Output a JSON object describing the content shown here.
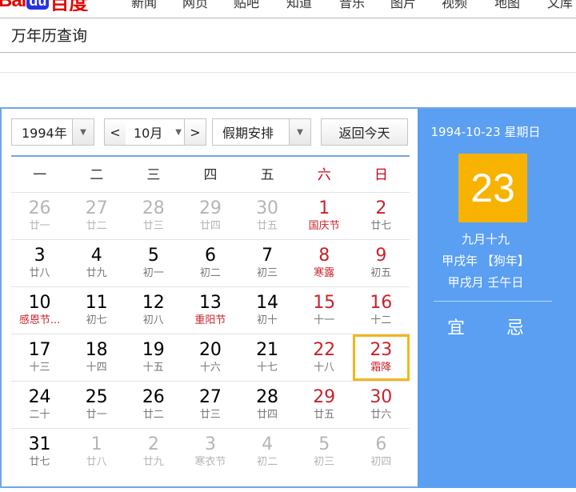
{
  "nav": {
    "logo_bai": "Bai",
    "logo_du": "du",
    "logo_cn": "百度",
    "items": [
      "新闻",
      "网页",
      "贴吧",
      "知道",
      "音乐",
      "图片",
      "视频",
      "地图",
      "文库"
    ]
  },
  "search": {
    "query": "万年历查询"
  },
  "controls": {
    "year": "1994年",
    "prev": "<",
    "month": "10月",
    "next": ">",
    "holiday": "假期安排",
    "today": "返回今天"
  },
  "weekdays": [
    "一",
    "二",
    "三",
    "四",
    "五",
    "六",
    "日"
  ],
  "weeks": [
    [
      {
        "day": "26",
        "lunar": "廿一",
        "other": true
      },
      {
        "day": "27",
        "lunar": "廿二",
        "other": true
      },
      {
        "day": "28",
        "lunar": "廿三",
        "other": true
      },
      {
        "day": "29",
        "lunar": "廿四",
        "other": true
      },
      {
        "day": "30",
        "lunar": "廿五",
        "other": true
      },
      {
        "day": "1",
        "lunar": "国庆节",
        "festival": true,
        "weekend": true
      },
      {
        "day": "2",
        "lunar": "廿七",
        "weekend": true
      }
    ],
    [
      {
        "day": "3",
        "lunar": "廿八"
      },
      {
        "day": "4",
        "lunar": "廿九"
      },
      {
        "day": "5",
        "lunar": "初一"
      },
      {
        "day": "6",
        "lunar": "初二"
      },
      {
        "day": "7",
        "lunar": "初三"
      },
      {
        "day": "8",
        "lunar": "寒露",
        "festival": true,
        "weekend": true
      },
      {
        "day": "9",
        "lunar": "初五",
        "weekend": true
      }
    ],
    [
      {
        "day": "10",
        "lunar": "感恩节...",
        "festival": true
      },
      {
        "day": "11",
        "lunar": "初七"
      },
      {
        "day": "12",
        "lunar": "初八"
      },
      {
        "day": "13",
        "lunar": "重阳节",
        "festival": true
      },
      {
        "day": "14",
        "lunar": "初十"
      },
      {
        "day": "15",
        "lunar": "十一",
        "weekend": true
      },
      {
        "day": "16",
        "lunar": "十二",
        "weekend": true
      }
    ],
    [
      {
        "day": "17",
        "lunar": "十三"
      },
      {
        "day": "18",
        "lunar": "十四"
      },
      {
        "day": "19",
        "lunar": "十五"
      },
      {
        "day": "20",
        "lunar": "十六"
      },
      {
        "day": "21",
        "lunar": "十七"
      },
      {
        "day": "22",
        "lunar": "十八",
        "weekend": true
      },
      {
        "day": "23",
        "lunar": "霜降",
        "festival": true,
        "weekend": true,
        "selected": true
      }
    ],
    [
      {
        "day": "24",
        "lunar": "二十"
      },
      {
        "day": "25",
        "lunar": "廿一"
      },
      {
        "day": "26",
        "lunar": "廿二"
      },
      {
        "day": "27",
        "lunar": "廿三"
      },
      {
        "day": "28",
        "lunar": "廿四"
      },
      {
        "day": "29",
        "lunar": "廿五",
        "weekend": true
      },
      {
        "day": "30",
        "lunar": "廿六",
        "weekend": true
      }
    ],
    [
      {
        "day": "31",
        "lunar": "廿七"
      },
      {
        "day": "1",
        "lunar": "廿八",
        "other": true
      },
      {
        "day": "2",
        "lunar": "廿九",
        "other": true
      },
      {
        "day": "3",
        "lunar": "寒衣节",
        "other": true
      },
      {
        "day": "4",
        "lunar": "初二",
        "other": true
      },
      {
        "day": "5",
        "lunar": "初三",
        "other": true
      },
      {
        "day": "6",
        "lunar": "初四",
        "other": true
      }
    ]
  ],
  "panel": {
    "date": "1994-10-23 星期日",
    "day": "23",
    "lunar": "九月十九",
    "year_gz": "甲戌年 【狗年】",
    "month_gz": "甲戌月 壬午日",
    "yi": "宜",
    "ji": "忌"
  },
  "colors": {
    "accent": "#5a9ff2",
    "border": "#6fa6ea",
    "highlight": "#f7b300",
    "red": "#c8232a"
  }
}
